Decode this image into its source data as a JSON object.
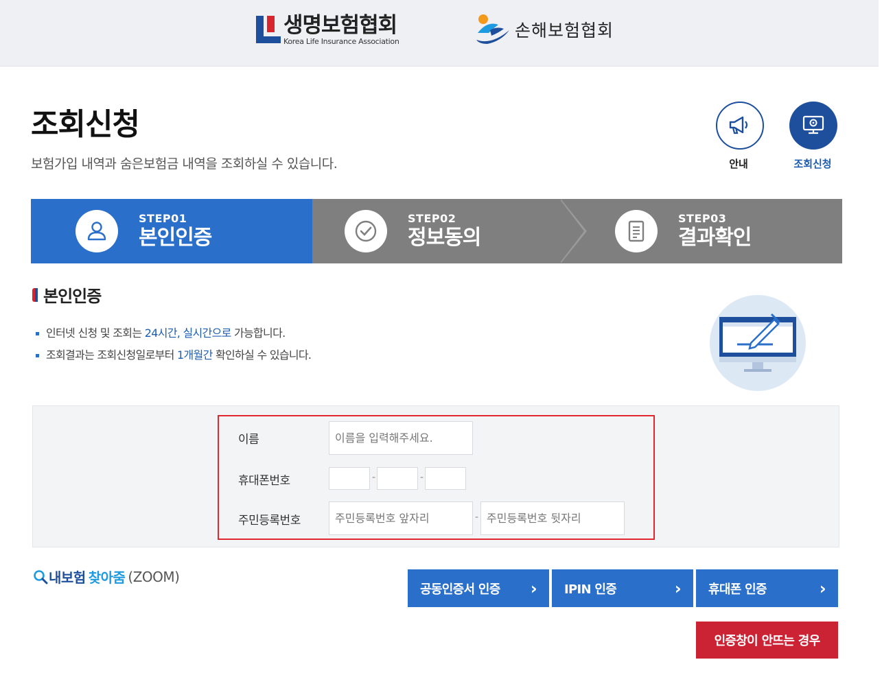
{
  "header": {
    "life_logo_ko": "생명보험협회",
    "life_logo_en": "Korea Life Insurance Association",
    "nonlife_logo_ko": "손해보험협회"
  },
  "page": {
    "title": "조회신청",
    "subtitle": "보험가입 내역과 숨은보험금 내역을 조회하실 수 있습니다."
  },
  "shortcuts": {
    "guide_label": "안내",
    "request_label": "조회신청"
  },
  "steps": [
    {
      "num": "STEP01",
      "name": "본인인증",
      "active": true
    },
    {
      "num": "STEP02",
      "name": "정보동의",
      "active": false
    },
    {
      "num": "STEP03",
      "name": "결과확인",
      "active": false
    }
  ],
  "section": {
    "title": "본인인증",
    "bullet1": {
      "pre": "인터넷 신청 및 조회는 ",
      "hl": "24시간, 실시간으로",
      "post": " 가능합니다."
    },
    "bullet2": {
      "pre": "조회결과는 조회신청일로부터 ",
      "hl": "1개월간",
      "post": " 확인하실 수 있습니다."
    }
  },
  "form": {
    "name_label": "이름",
    "name_placeholder": "이름을 입력해주세요.",
    "phone_label": "휴대폰번호",
    "phone_sep": "-",
    "rrn_label": "주민등록번호",
    "rrn_front_placeholder": "주민등록번호 앞자리",
    "rrn_back_placeholder": "주민등록번호 뒷자리",
    "rrn_sep": "-"
  },
  "bottom": {
    "zoom_a": "내보험",
    "zoom_b": "찾아줌",
    "zoom_c": "(ZOOM)",
    "btn_cert": "공동인증서 인증",
    "btn_ipin": "IPIN 인증",
    "btn_phone": "휴대폰 인증",
    "btn_help": "인증창이 안뜨는 경우"
  },
  "colors": {
    "primary_blue": "#2a6fc9",
    "navy": "#1d4f9c",
    "step_gray": "#7f7f7f",
    "alert_red": "#cb2234"
  }
}
